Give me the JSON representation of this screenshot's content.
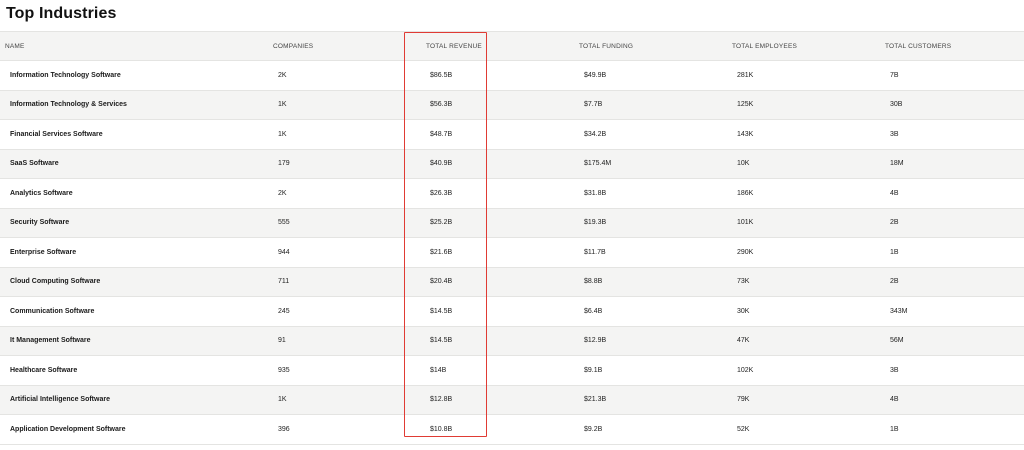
{
  "page_title": "Top Industries",
  "columns": {
    "name": "NAME",
    "companies": "COMPANIES",
    "total_revenue": "TOTAL REVENUE",
    "total_funding": "TOTAL FUNDING",
    "total_employees": "TOTAL EMPLOYEES",
    "total_customers": "TOTAL CUSTOMERS"
  },
  "highlight_color": "#e03b34",
  "rows": [
    {
      "name": "Information Technology Software",
      "companies": "2K",
      "total_revenue": "$86.5B",
      "total_funding": "$49.9B",
      "total_employees": "281K",
      "total_customers": "7B"
    },
    {
      "name": "Information Technology & Services",
      "companies": "1K",
      "total_revenue": "$56.3B",
      "total_funding": "$7.7B",
      "total_employees": "125K",
      "total_customers": "30B"
    },
    {
      "name": "Financial Services Software",
      "companies": "1K",
      "total_revenue": "$48.7B",
      "total_funding": "$34.2B",
      "total_employees": "143K",
      "total_customers": "3B"
    },
    {
      "name": "SaaS Software",
      "companies": "179",
      "total_revenue": "$40.9B",
      "total_funding": "$175.4M",
      "total_employees": "10K",
      "total_customers": "18M"
    },
    {
      "name": "Analytics Software",
      "companies": "2K",
      "total_revenue": "$26.3B",
      "total_funding": "$31.8B",
      "total_employees": "186K",
      "total_customers": "4B"
    },
    {
      "name": "Security Software",
      "companies": "555",
      "total_revenue": "$25.2B",
      "total_funding": "$19.3B",
      "total_employees": "101K",
      "total_customers": "2B"
    },
    {
      "name": "Enterprise Software",
      "companies": "944",
      "total_revenue": "$21.6B",
      "total_funding": "$11.7B",
      "total_employees": "290K",
      "total_customers": "1B"
    },
    {
      "name": "Cloud Computing Software",
      "companies": "711",
      "total_revenue": "$20.4B",
      "total_funding": "$8.8B",
      "total_employees": "73K",
      "total_customers": "2B"
    },
    {
      "name": "Communication Software",
      "companies": "245",
      "total_revenue": "$14.5B",
      "total_funding": "$6.4B",
      "total_employees": "30K",
      "total_customers": "343M"
    },
    {
      "name": "It Management Software",
      "companies": "91",
      "total_revenue": "$14.5B",
      "total_funding": "$12.9B",
      "total_employees": "47K",
      "total_customers": "56M"
    },
    {
      "name": "Healthcare Software",
      "companies": "935",
      "total_revenue": "$14B",
      "total_funding": "$9.1B",
      "total_employees": "102K",
      "total_customers": "3B"
    },
    {
      "name": "Artificial Intelligence Software",
      "companies": "1K",
      "total_revenue": "$12.8B",
      "total_funding": "$21.3B",
      "total_employees": "79K",
      "total_customers": "4B"
    },
    {
      "name": "Application Development Software",
      "companies": "396",
      "total_revenue": "$10.8B",
      "total_funding": "$9.2B",
      "total_employees": "52K",
      "total_customers": "1B"
    }
  ]
}
